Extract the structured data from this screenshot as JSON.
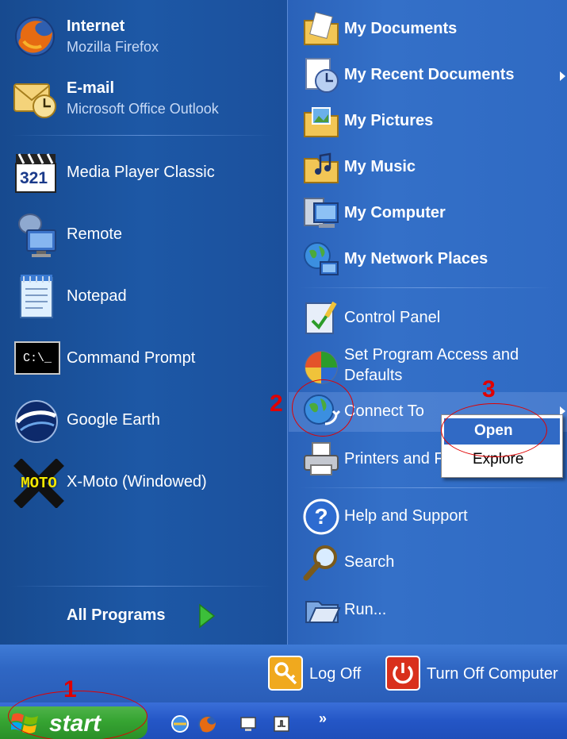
{
  "left_pane": {
    "pinned": [
      {
        "title": "Internet",
        "subtitle": "Mozilla Firefox",
        "icon": "firefox-icon"
      },
      {
        "title": "E-mail",
        "subtitle": "Microsoft Office Outlook",
        "icon": "outlook-icon"
      }
    ],
    "recent": [
      {
        "label": "Media Player Classic",
        "icon": "media-player-classic-icon"
      },
      {
        "label": "Remote",
        "icon": "remote-desktop-icon"
      },
      {
        "label": "Notepad",
        "icon": "notepad-icon"
      },
      {
        "label": "Command Prompt",
        "icon": "command-prompt-icon"
      },
      {
        "label": "Google Earth",
        "icon": "google-earth-icon"
      },
      {
        "label": "X-Moto (Windowed)",
        "icon": "x-moto-icon"
      }
    ],
    "mpc_badge": "321",
    "cmd_badge": "C:\\_",
    "xmoto_badge": "MOTO",
    "all_programs": "All Programs"
  },
  "right_pane": {
    "places": [
      {
        "label": "My Documents",
        "icon": "my-documents-icon"
      },
      {
        "label": "My Recent Documents",
        "icon": "recent-documents-icon"
      },
      {
        "label": "My Pictures",
        "icon": "my-pictures-icon"
      },
      {
        "label": "My Music",
        "icon": "my-music-icon"
      },
      {
        "label": "My Computer",
        "icon": "my-computer-icon"
      },
      {
        "label": "My Network Places",
        "icon": "network-places-icon"
      }
    ],
    "settings": [
      {
        "label": "Control Panel",
        "icon": "control-panel-icon"
      },
      {
        "label": "Set Program Access and",
        "label2": "Defaults",
        "icon": "program-access-icon"
      },
      {
        "label": "Connect To",
        "icon": "connect-to-icon"
      },
      {
        "label": "Printers and F",
        "icon": "printers-icon"
      }
    ],
    "help": [
      {
        "label": "Help and Support",
        "icon": "help-icon"
      },
      {
        "label": "Search",
        "icon": "search-icon"
      },
      {
        "label": "Run...",
        "icon": "run-icon"
      }
    ]
  },
  "bottom_bar": {
    "log_off": "Log Off",
    "turn_off": "Turn Off Computer"
  },
  "context_menu": {
    "open": "Open",
    "explore": "Explore"
  },
  "taskbar": {
    "start": "start",
    "overflow": "»"
  },
  "annotations": {
    "step1": "1",
    "step2": "2",
    "step3": "3",
    "color": "#e00000"
  },
  "colors": {
    "left_pane": "#1d58a6",
    "right_pane": "#3470c8",
    "start_green": "#36a432",
    "highlight": "#316ac5"
  }
}
